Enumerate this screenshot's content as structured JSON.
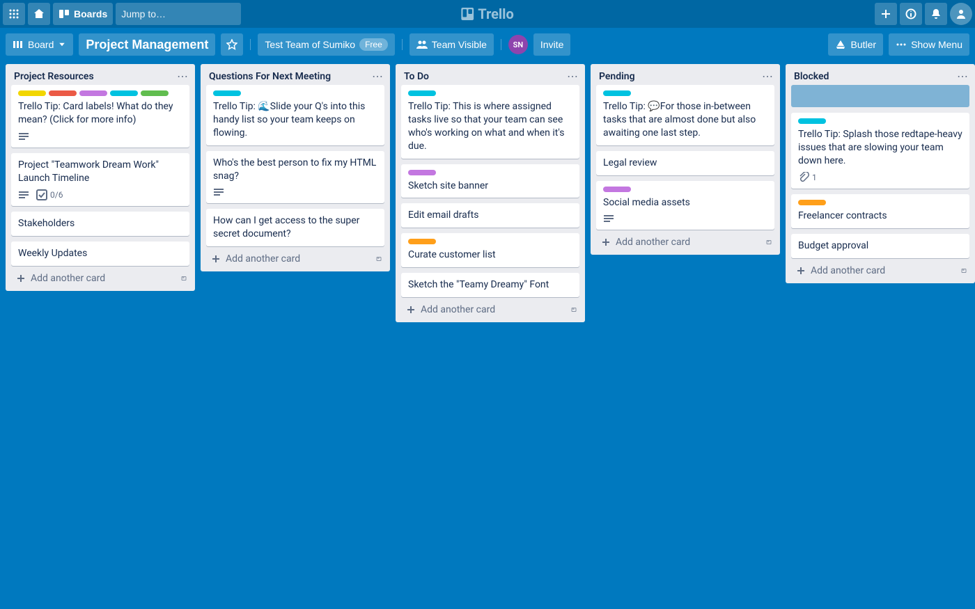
{
  "app_name": "Trello",
  "header": {
    "boards_label": "Boards",
    "search_placeholder": "Jump to…"
  },
  "board_bar": {
    "view_label": "Board",
    "board_name": "Project Management",
    "team_label": "Test Team of Sumiko",
    "free_badge": "Free",
    "visibility": "Team Visible",
    "member_initials": "SN",
    "invite_label": "Invite",
    "butler_label": "Butler",
    "show_menu_label": "Show Menu"
  },
  "colors": {
    "yellow": "#f2d600",
    "red": "#eb5a46",
    "purple": "#c377e0",
    "sky": "#00c2e0",
    "lime": "#61bd4f",
    "orange": "#ff9f1a"
  },
  "add_card_label": "Add another card",
  "lists": [
    {
      "title": "Project Resources",
      "cards": [
        {
          "labels": [
            "yellow",
            "red",
            "purple",
            "sky",
            "lime"
          ],
          "text": "Trello Tip: Card labels! What do they mean? (Click for more info)",
          "badges": {
            "description": true
          }
        },
        {
          "text": "Project \"Teamwork Dream Work\" Launch Timeline",
          "badges": {
            "description": true,
            "checklist": "0/6"
          }
        },
        {
          "text": "Stakeholders"
        },
        {
          "text": "Weekly Updates"
        }
      ]
    },
    {
      "title": "Questions For Next Meeting",
      "cards": [
        {
          "labels": [
            "sky"
          ],
          "text": "Trello Tip: 🌊Slide your Q's into this handy list so your team keeps on flowing."
        },
        {
          "text": "Who's the best person to fix my HTML snag?",
          "badges": {
            "description": true
          }
        },
        {
          "text": "How can I get access to the super secret document?"
        }
      ]
    },
    {
      "title": "To Do",
      "cards": [
        {
          "labels": [
            "sky"
          ],
          "text": "Trello Tip: This is where assigned tasks live so that your team can see who's working on what and when it's due."
        },
        {
          "labels": [
            "purple"
          ],
          "text": "Sketch site banner"
        },
        {
          "text": "Edit email drafts"
        },
        {
          "labels": [
            "orange"
          ],
          "text": "Curate customer list"
        },
        {
          "text": "Sketch the \"Teamy Dreamy\" Font"
        }
      ]
    },
    {
      "title": "Pending",
      "cards": [
        {
          "labels": [
            "sky"
          ],
          "text": "Trello Tip: 💬For those in-between tasks that are almost done but also awaiting one last step."
        },
        {
          "text": "Legal review"
        },
        {
          "labels": [
            "purple"
          ],
          "text": "Social media assets",
          "badges": {
            "description": true
          }
        }
      ]
    },
    {
      "title": "Blocked",
      "cards": [
        {
          "placeholder": true
        },
        {
          "labels": [
            "sky"
          ],
          "text": "Trello Tip: Splash those redtape-heavy issues that are slowing your team down here.",
          "badges": {
            "attachments": "1"
          }
        },
        {
          "labels": [
            "orange"
          ],
          "text": "Freelancer contracts"
        },
        {
          "text": "Budget approval"
        }
      ]
    }
  ]
}
